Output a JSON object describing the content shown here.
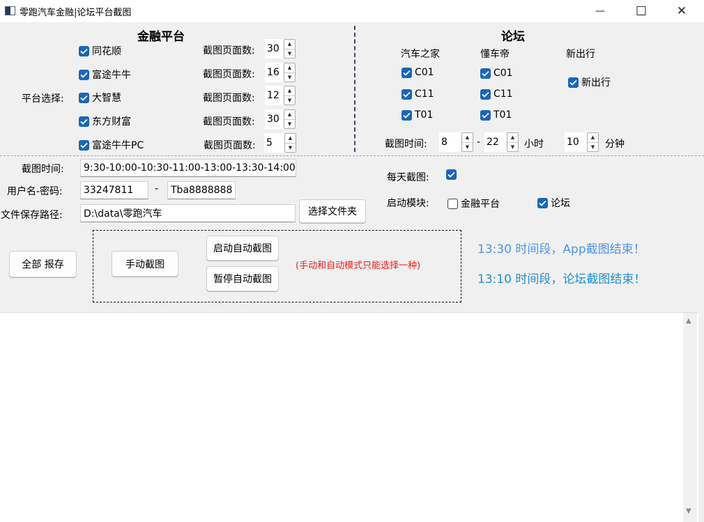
{
  "window": {
    "title": "零跑汽车金融|论坛平台截图",
    "minimize_glyph": "—",
    "maximize_glyph": "☐",
    "close_glyph": "✕"
  },
  "finance": {
    "section_title": "金融平台",
    "platform_label": "平台选择:",
    "page_count_label": "截图页面数:",
    "platforms": [
      {
        "name": "同花顺",
        "checked": true,
        "pages": "30"
      },
      {
        "name": "富途牛牛",
        "checked": true,
        "pages": "16"
      },
      {
        "name": "大智慧",
        "checked": true,
        "pages": "12"
      },
      {
        "name": "东方财富",
        "checked": true,
        "pages": "30"
      },
      {
        "name": "富途牛牛PC",
        "checked": true,
        "pages": "5"
      }
    ]
  },
  "forum": {
    "section_title": "论坛",
    "columns": [
      {
        "name": "汽车之家",
        "items": [
          "C01",
          "C11",
          "T01"
        ]
      },
      {
        "name": "懂车帝",
        "items": [
          "C01",
          "C11",
          "T01"
        ]
      },
      {
        "name": "新出行",
        "items": [
          "新出行"
        ]
      }
    ],
    "time_label": "截图时间:",
    "hour_start": "8",
    "dash": "-",
    "hour_end": "22",
    "hour_unit": "小时",
    "minute": "10",
    "minute_unit": "分钟"
  },
  "settings": {
    "time_label": "截图时间:",
    "time_value": "9:30-10:00-10:30-11:00-13:00-13:30-14:00",
    "credentials_label": "用户名-密码:",
    "username": "33247811",
    "credentials_dash": "-",
    "password": "Tba8888888",
    "path_label": "文件保存路径:",
    "path_value": "D:\\data\\零跑汽车",
    "choose_folder_button": "选择文件夹",
    "daily_label": "每天截图:",
    "modules_label": "启动模块:",
    "module_finance": "金融平台",
    "module_forum": "论坛"
  },
  "actions": {
    "save_all_button": "全部 报存",
    "manual_button": "手动截图",
    "start_auto_button": "启动自动截图",
    "pause_auto_button": "暂停自动截图",
    "warning": "(手动和自动模式只能选择一种)"
  },
  "status": {
    "app_message": "13:30 时间段，App截图结束！",
    "forum_message": "13:10 时间段，论坛截图结束！",
    "app_color": "#4f95e6",
    "forum_color": "#1f8fd0"
  },
  "icons": [
    "app-icon",
    "check-icon",
    "spin-up-icon",
    "spin-down-icon",
    "scroll-up-icon",
    "scroll-down-icon"
  ]
}
